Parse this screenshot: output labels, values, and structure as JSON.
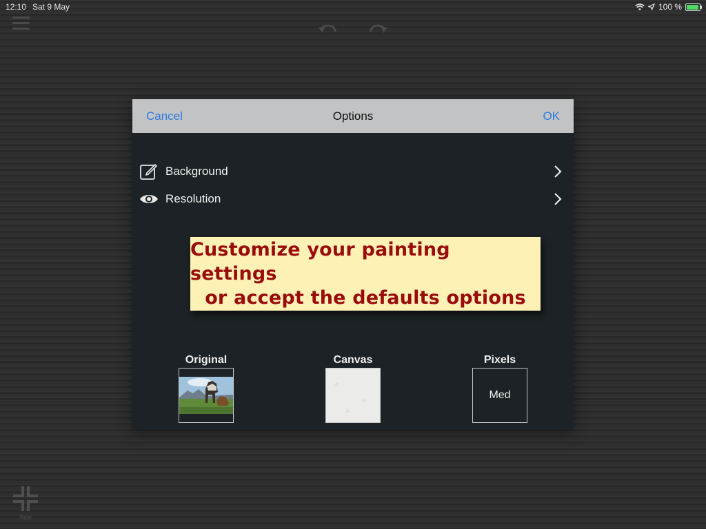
{
  "status": {
    "time": "12:10",
    "date": "Sat 9 May",
    "battery": "100 %"
  },
  "colors": {
    "accent": "#2f7be0",
    "tooltip_text": "#990c0c",
    "tooltip_bg": "#fdf1b5",
    "dialog_bg": "#1c2225",
    "header_bg": "#c2c3c4"
  },
  "toolbar": {
    "menu_icon": "hamburger-icon",
    "undo_icon": "undo-icon",
    "redo_icon": "redo-icon",
    "size_label": "Size",
    "size_icon": "resize-icon"
  },
  "dialog": {
    "cancel_label": "Cancel",
    "title": "Options",
    "ok_label": "OK",
    "options": [
      {
        "label": "Background",
        "icon": "edit-icon"
      },
      {
        "label": "Resolution",
        "icon": "eye-icon"
      }
    ],
    "tooltip": {
      "line1": "Customize your painting settings",
      "line2": "or accept the defaults options"
    },
    "thumbs": {
      "original_label": "Original",
      "canvas_label": "Canvas",
      "pixels_label": "Pixels",
      "pixels_value": "Med"
    }
  }
}
